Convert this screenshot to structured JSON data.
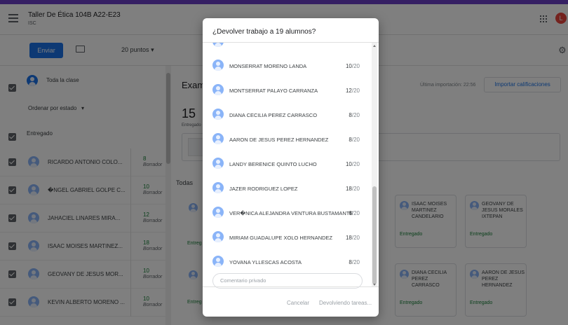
{
  "header": {
    "title": "Taller De Ética 104B A22-E23",
    "subtitle": "ISC",
    "avatar_letter": "L"
  },
  "toolbar": {
    "send_label": "Enviar",
    "points_label": "20 puntos",
    "points_caret": "▾"
  },
  "left_panel": {
    "all_class_label": "Toda la clase",
    "sort_label": "Ordenar por estado",
    "sort_caret": "▾",
    "group_label": "Entregado",
    "students": [
      {
        "name": "RICARDO ANTONIO COLO...",
        "score": "8",
        "status": "Borrador"
      },
      {
        "name": "�NGEL GABRIEL GOLPE C...",
        "score": "10",
        "status": "Borrador"
      },
      {
        "name": "JAHACIEL LINARES MIRA...",
        "score": "12",
        "status": "Borrador"
      },
      {
        "name": "ISAAC MOISES MARTINEZ...",
        "score": "18",
        "status": "Borrador"
      },
      {
        "name": "GEOVANY DE JESUS MOR...",
        "score": "10",
        "status": "Borrador"
      },
      {
        "name": "KEVIN ALBERTO MORENO ...",
        "score": "10",
        "status": "Borrador"
      }
    ]
  },
  "main": {
    "assignment_title": "Exam",
    "submitted_count": "15",
    "submitted_label": "Entregado",
    "last_import": "Última importación: 22:56",
    "import_button": "Importar calificaciones",
    "filter_label": "Todas",
    "partial_status": "Entreg",
    "cards": [
      {
        "name": "ISAAC MOISES MARTINEZ CANDELARIO",
        "status": "Entregado"
      },
      {
        "name": "GEOVANY DE JESUS MORALES IXTEPAN",
        "status": "Entregado"
      },
      {
        "name": "DIANA CECILIA PEREZ CARRASCO",
        "status": "Entregado"
      },
      {
        "name": "AARON DE JESUS PEREZ HERNANDEZ",
        "status": "Entregado"
      }
    ]
  },
  "dialog": {
    "title": "¿Devolver trabajo a 19 alumnos?",
    "rows": [
      {
        "name": "MONSERRAT MORENO LANDA",
        "grade": "10",
        "max": "/20"
      },
      {
        "name": "MONTSERRAT PALAYO CARRANZA",
        "grade": "12",
        "max": "/20"
      },
      {
        "name": "DIANA CECILIA PEREZ CARRASCO",
        "grade": "8",
        "max": "/20"
      },
      {
        "name": "AARON DE JESUS PEREZ HERNANDEZ",
        "grade": "8",
        "max": "/20"
      },
      {
        "name": "LANDY BERENICE QUINTO LUCHO",
        "grade": "10",
        "max": "/20"
      },
      {
        "name": "JAZER RODRIGUEZ LOPEZ",
        "grade": "18",
        "max": "/20"
      },
      {
        "name": "VER�NICA ALEJANDRA VENTURA BUSTAMANTE",
        "grade": "6",
        "max": "/20"
      },
      {
        "name": "MIRIAM GUADALUPE XOLO HERNANDEZ",
        "grade": "18",
        "max": "/20"
      },
      {
        "name": "YOVANA YLLESCAS ACOSTA",
        "grade": "8",
        "max": "/20"
      }
    ],
    "private_comment_placeholder": "Comentario privado",
    "cancel_label": "Cancelar",
    "returning_label": "Devolviendo tareas..."
  }
}
